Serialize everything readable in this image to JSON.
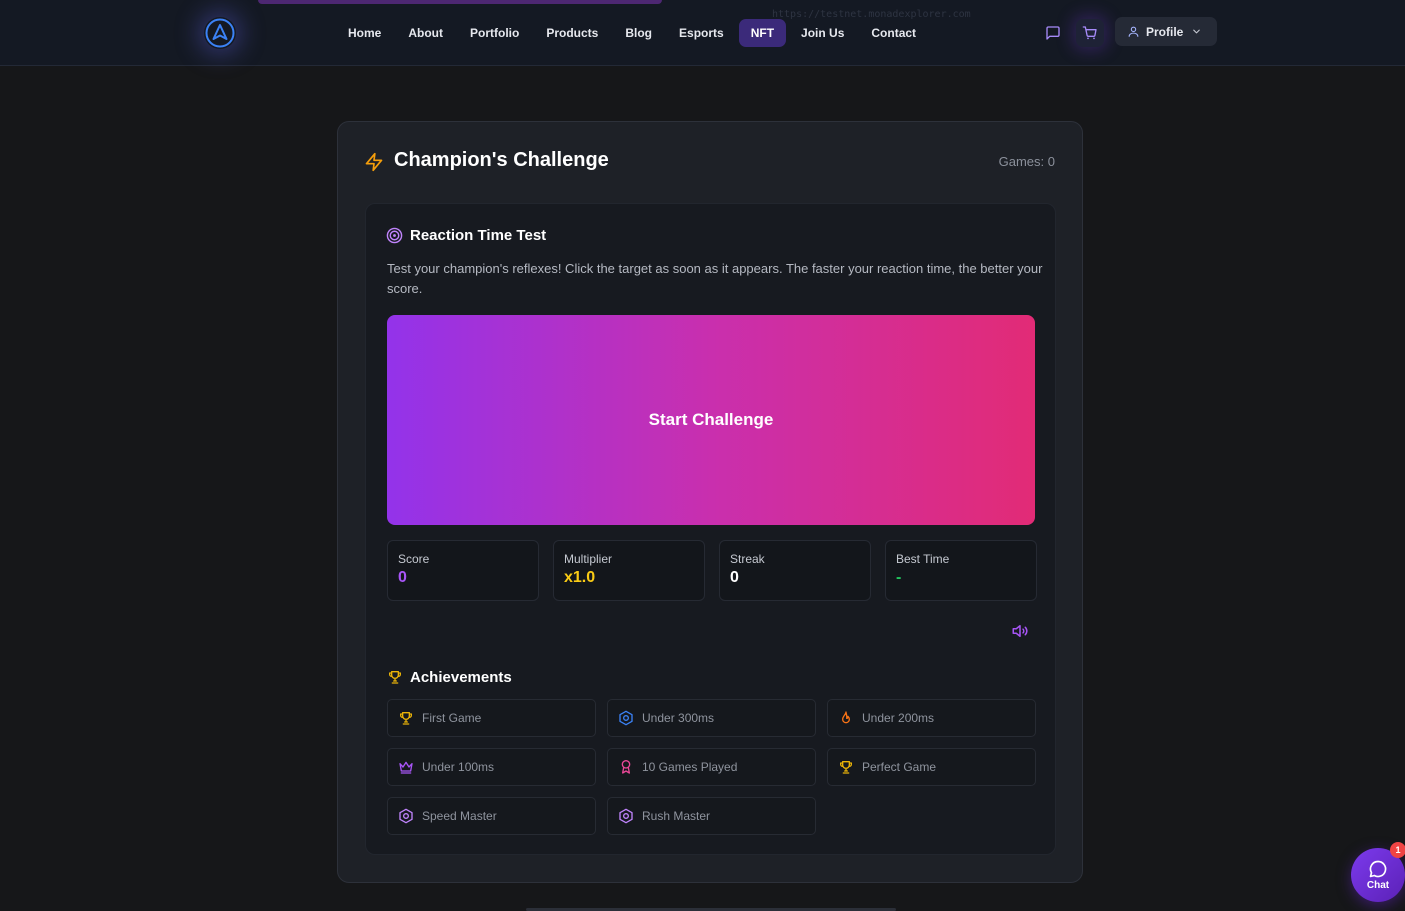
{
  "navbar": {
    "url_ghost": "https://testnet.monadexplorer.com",
    "links": [
      {
        "label": "Home",
        "active": false
      },
      {
        "label": "About",
        "active": false
      },
      {
        "label": "Portfolio",
        "active": false
      },
      {
        "label": "Products",
        "active": false
      },
      {
        "label": "Blog",
        "active": false
      },
      {
        "label": "Esports",
        "active": false
      },
      {
        "label": "NFT",
        "active": true
      },
      {
        "label": "Join Us",
        "active": false
      },
      {
        "label": "Contact",
        "active": false
      }
    ],
    "icons": {
      "logo": "navigation-arrow-icon",
      "messages": "message-square-icon",
      "cart": "shopping-cart-icon"
    },
    "profile": {
      "label": "Profile",
      "icon": "user-icon",
      "caret": "chevron-down-icon"
    }
  },
  "challenge": {
    "title": "Champion's Challenge",
    "title_icon": "zap-icon",
    "games_count": "Games: 0",
    "panel": {
      "title": "Reaction Time Test",
      "icon": "target-icon",
      "description": "Test your champion's reflexes! Click the target as soon as it appears. The faster your reaction time, the better your score.",
      "start_label": "Start Challenge"
    },
    "stats": [
      {
        "label": "Score",
        "value": "0",
        "color": "#a855f7"
      },
      {
        "label": "Multiplier",
        "value": "x1.0",
        "color": "#facc15"
      },
      {
        "label": "Streak",
        "value": "0",
        "color": "#ffffff"
      },
      {
        "label": "Best Time",
        "value": "-",
        "color": "#22c55e"
      }
    ],
    "sound_icon": "volume-icon",
    "achievements_title": "Achievements",
    "achievements_icon": "trophy-icon",
    "achievements": [
      {
        "label": "First Game",
        "icon": "trophy-icon",
        "color": "#eab308"
      },
      {
        "label": "Under 300ms",
        "icon": "hexagon-icon",
        "color": "#3b82f6"
      },
      {
        "label": "Under 200ms",
        "icon": "flame-icon",
        "color": "#f97316"
      },
      {
        "label": "Under 100ms",
        "icon": "crown-icon",
        "color": "#a855f7"
      },
      {
        "label": "10 Games Played",
        "icon": "award-icon",
        "color": "#ec4899"
      },
      {
        "label": "Perfect Game",
        "icon": "trophy-icon",
        "color": "#eab308"
      },
      {
        "label": "Speed Master",
        "icon": "hexagon-icon",
        "color": "#c084fc"
      },
      {
        "label": "Rush Master",
        "icon": "hexagon-icon",
        "color": "#c084fc"
      }
    ]
  },
  "chat": {
    "label": "Chat",
    "badge": "1",
    "icon": "chat-bubble-icon"
  }
}
